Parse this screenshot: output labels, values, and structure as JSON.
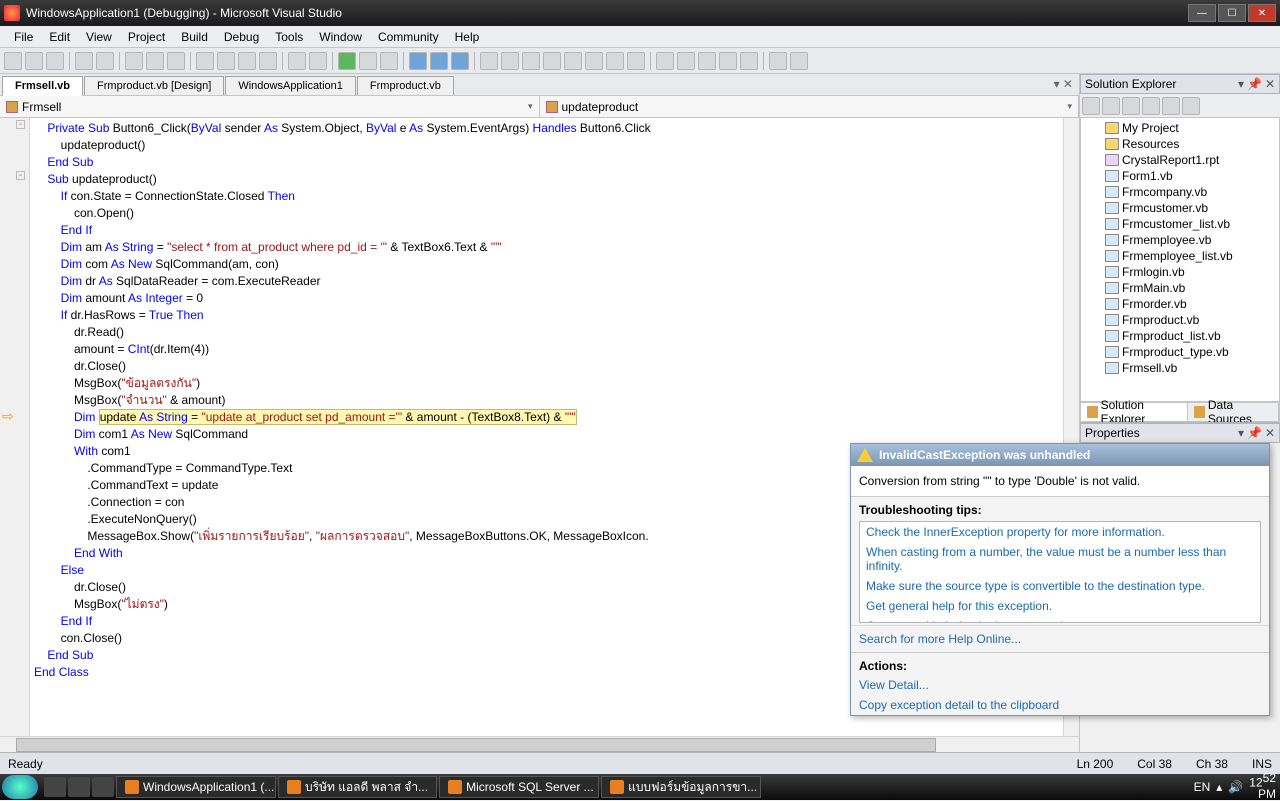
{
  "window": {
    "title": "WindowsApplication1 (Debugging) - Microsoft Visual Studio"
  },
  "menu": {
    "items": [
      "File",
      "Edit",
      "View",
      "Project",
      "Build",
      "Debug",
      "Tools",
      "Window",
      "Community",
      "Help"
    ]
  },
  "tabs": {
    "items": [
      "Frmsell.vb",
      "Frmproduct.vb [Design]",
      "WindowsApplication1",
      "Frmproduct.vb"
    ],
    "active": 0
  },
  "nav": {
    "left": "Frmsell",
    "right": "updateproduct"
  },
  "code": {
    "lines": [
      {
        "i": 0,
        "t": "    <kw>Private</kw> <kw>Sub</kw> Button6_Click(<kw>ByVal</kw> sender <kw>As</kw> System.Object, <kw>ByVal</kw> e <kw>As</kw> System.EventArgs) <kw>Handles</kw> Button6.Click"
      },
      {
        "i": 0,
        "t": "        updateproduct()"
      },
      {
        "i": 0,
        "t": "    <kw>End</kw> <kw>Sub</kw>"
      },
      {
        "i": 0,
        "t": "    <kw>Sub</kw> updateproduct()"
      },
      {
        "i": 0,
        "t": "        <kw>If</kw> con.State = ConnectionState.Closed <kw>Then</kw>"
      },
      {
        "i": 0,
        "t": "            con.Open()"
      },
      {
        "i": 0,
        "t": "        <kw>End</kw> <kw>If</kw>"
      },
      {
        "i": 0,
        "t": "        <kw>Dim</kw> am <kw>As</kw> <kw>String</kw> = <str>\"select * from at_product where pd_id = '\"</str> & TextBox6.Text & <str>\"'\"</str>"
      },
      {
        "i": 0,
        "t": "        <kw>Dim</kw> com <kw>As</kw> <kw>New</kw> SqlCommand(am, con)"
      },
      {
        "i": 0,
        "t": "        <kw>Dim</kw> dr <kw>As</kw> SqlDataReader = com.ExecuteReader"
      },
      {
        "i": 0,
        "t": "        <kw>Dim</kw> amount <kw>As</kw> <kw>Integer</kw> = 0"
      },
      {
        "i": 0,
        "t": "        <kw>If</kw> dr.HasRows = <kw>True</kw> <kw>Then</kw>"
      },
      {
        "i": 0,
        "t": "            dr.Read()"
      },
      {
        "i": 0,
        "t": "            amount = <kw>CInt</kw>(dr.Item(4))"
      },
      {
        "i": 0,
        "t": "            dr.Close()"
      },
      {
        "i": 0,
        "t": "            MsgBox(<str>\"ข้อมูลตรงกัน\"</str>)"
      },
      {
        "i": 0,
        "t": "            MsgBox(<str>\"จำนวน\"</str> & amount)"
      },
      {
        "i": 0,
        "hl": true,
        "t": "            <kw>Dim</kw> <span class='hl'>update <kw>As</kw> <kw>String</kw> = <str>\"update at_product set pd_amount ='\"</str> & amount - (TextBox8.Text) & <str>\"'\"</str></span>"
      },
      {
        "i": 0,
        "t": "            <kw>Dim</kw> com1 <kw>As</kw> <kw>New</kw> SqlCommand"
      },
      {
        "i": 0,
        "t": "            <kw>With</kw> com1"
      },
      {
        "i": 0,
        "t": "                .CommandType = CommandType.Text"
      },
      {
        "i": 0,
        "t": "                .CommandText = update"
      },
      {
        "i": 0,
        "t": "                .Connection = con"
      },
      {
        "i": 0,
        "t": "                .ExecuteNonQuery()"
      },
      {
        "i": 0,
        "t": "                MessageBox.Show(<str>\"เพิ่มรายการเรียบร้อย\"</str>, <str>\"ผลการตรวจสอบ\"</str>, MessageBoxButtons.OK, MessageBoxIcon."
      },
      {
        "i": 0,
        "t": "            <kw>End</kw> <kw>With</kw>"
      },
      {
        "i": 0,
        "t": "        <kw>Else</kw>"
      },
      {
        "i": 0,
        "t": "            dr.Close()"
      },
      {
        "i": 0,
        "t": "            MsgBox(<str>\"ไม่ตรง\"</str>)"
      },
      {
        "i": 0,
        "t": "        <kw>End</kw> <kw>If</kw>"
      },
      {
        "i": 0,
        "t": "        con.Close()"
      },
      {
        "i": 0,
        "t": "    <kw>End</kw> <kw>Sub</kw>"
      },
      {
        "i": 0,
        "t": "<kw>End</kw> <kw>Class</kw>"
      }
    ]
  },
  "solution": {
    "title": "Solution Explorer",
    "items": [
      {
        "label": "My Project",
        "icon": "folder"
      },
      {
        "label": "Resources",
        "icon": "folder"
      },
      {
        "label": "CrystalReport1.rpt",
        "icon": "rpt"
      },
      {
        "label": "Form1.vb",
        "icon": "vb"
      },
      {
        "label": "Frmcompany.vb",
        "icon": "vb"
      },
      {
        "label": "Frmcustomer.vb",
        "icon": "vb"
      },
      {
        "label": "Frmcustomer_list.vb",
        "icon": "vb"
      },
      {
        "label": "Frmemployee.vb",
        "icon": "vb"
      },
      {
        "label": "Frmemployee_list.vb",
        "icon": "vb"
      },
      {
        "label": "Frmlogin.vb",
        "icon": "vb"
      },
      {
        "label": "FrmMain.vb",
        "icon": "vb"
      },
      {
        "label": "Frmorder.vb",
        "icon": "vb"
      },
      {
        "label": "Frmproduct.vb",
        "icon": "vb"
      },
      {
        "label": "Frmproduct_list.vb",
        "icon": "vb"
      },
      {
        "label": "Frmproduct_type.vb",
        "icon": "vb"
      },
      {
        "label": "Frmsell.vb",
        "icon": "vb"
      }
    ],
    "tabs": [
      "Solution Explorer",
      "Data Sources"
    ]
  },
  "properties": {
    "title": "Properties"
  },
  "exception": {
    "title": "InvalidCastException was unhandled",
    "message": "Conversion from string \"\" to type 'Double' is not valid.",
    "tips_header": "Troubleshooting tips:",
    "tips": [
      "Check the InnerException property for more information.",
      "When casting from a number, the value must be a number less than infinity.",
      "Make sure the source type is convertible to the destination type.",
      "Get general help for this exception.",
      "Get general help for the inner exception."
    ],
    "search": "Search for more Help Online...",
    "actions_header": "Actions:",
    "actions": [
      "View Detail...",
      "Copy exception detail to the clipboard"
    ]
  },
  "status": {
    "ready": "Ready",
    "ln": "Ln 200",
    "col": "Col 38",
    "ch": "Ch 38",
    "ins": "INS"
  },
  "taskbar": {
    "tasks": [
      {
        "label": "WindowsApplication1 (..."
      },
      {
        "label": "บริษัท แอลดี พลาส จำ..."
      },
      {
        "label": "Microsoft SQL Server ..."
      },
      {
        "label": "แบบฟอร์มข้อมูลการขา..."
      }
    ],
    "lang": "EN",
    "time": "12",
    "time2": "52",
    "ampm": "PM"
  }
}
